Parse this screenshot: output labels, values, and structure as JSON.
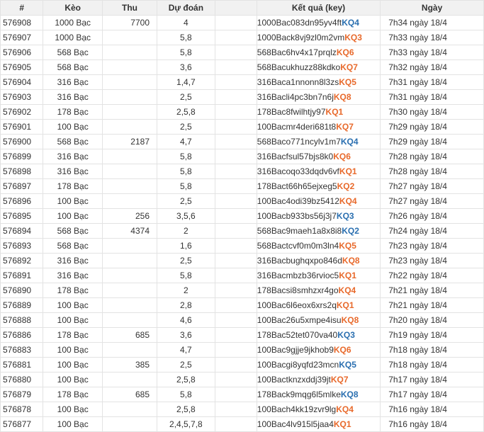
{
  "headers": {
    "id": "#",
    "bet": "Kèo",
    "thu": "Thu",
    "pred": "Dự đoán",
    "key": "Kết quả (key)",
    "date": "Ngày"
  },
  "colors": {
    "kq_orange": "#e8692b",
    "kq_blue": "#2a6fb0"
  },
  "rows": [
    {
      "id": "576908",
      "bet": "1000 Bạc",
      "thu": "7700",
      "pred": "4",
      "key": "1000Bac083dn95yv4ft",
      "kq": "KQ4",
      "kq_color": "#2a6fb0",
      "date": "7h34 ngày 18/4"
    },
    {
      "id": "576907",
      "bet": "1000 Bạc",
      "thu": "",
      "pred": "5,8",
      "key": "1000Back8vj9zl0m2vm",
      "kq": "KQ3",
      "kq_color": "#e8692b",
      "date": "7h33 ngày 18/4"
    },
    {
      "id": "576906",
      "bet": "568 Bạc",
      "thu": "",
      "pred": "5,8",
      "key": "568Bac6hv4x17prqlz",
      "kq": "KQ6",
      "kq_color": "#e8692b",
      "date": "7h33 ngày 18/4"
    },
    {
      "id": "576905",
      "bet": "568 Bạc",
      "thu": "",
      "pred": "3,6",
      "key": "568Bacukhuzz88kdko",
      "kq": "KQ7",
      "kq_color": "#e8692b",
      "date": "7h32 ngày 18/4"
    },
    {
      "id": "576904",
      "bet": "316 Bạc",
      "thu": "",
      "pred": "1,4,7",
      "key": "316Baca1nnonn8l3zs",
      "kq": "KQ5",
      "kq_color": "#e8692b",
      "date": "7h31 ngày 18/4"
    },
    {
      "id": "576903",
      "bet": "316 Bạc",
      "thu": "",
      "pred": "2,5",
      "key": "316Bacli4pc3bn7n6j",
      "kq": "KQ8",
      "kq_color": "#e8692b",
      "date": "7h31 ngày 18/4"
    },
    {
      "id": "576902",
      "bet": "178 Bạc",
      "thu": "",
      "pred": "2,5,8",
      "key": "178Bac8fwilhtjy97",
      "kq": "KQ1",
      "kq_color": "#e8692b",
      "date": "7h30 ngày 18/4"
    },
    {
      "id": "576901",
      "bet": "100 Bạc",
      "thu": "",
      "pred": "2,5",
      "key": "100Bacmr4deri681t8",
      "kq": "KQ7",
      "kq_color": "#e8692b",
      "date": "7h29 ngày 18/4"
    },
    {
      "id": "576900",
      "bet": "568 Bạc",
      "thu": "2187",
      "pred": "4,7",
      "key": "568Baco771ncylv1m7",
      "kq": "KQ4",
      "kq_color": "#2a6fb0",
      "date": "7h29 ngày 18/4"
    },
    {
      "id": "576899",
      "bet": "316 Bạc",
      "thu": "",
      "pred": "5,8",
      "key": "316Bacfsul57bjs8k0",
      "kq": "KQ6",
      "kq_color": "#e8692b",
      "date": "7h28 ngày 18/4"
    },
    {
      "id": "576898",
      "bet": "316 Bạc",
      "thu": "",
      "pred": "5,8",
      "key": "316Bacoqo33dqdv6vf",
      "kq": "KQ1",
      "kq_color": "#e8692b",
      "date": "7h28 ngày 18/4"
    },
    {
      "id": "576897",
      "bet": "178 Bạc",
      "thu": "",
      "pred": "5,8",
      "key": "178Bact66h65ejxeg5",
      "kq": "KQ2",
      "kq_color": "#e8692b",
      "date": "7h27 ngày 18/4"
    },
    {
      "id": "576896",
      "bet": "100 Bạc",
      "thu": "",
      "pred": "2,5",
      "key": "100Bac4odi39bz5412",
      "kq": "KQ4",
      "kq_color": "#e8692b",
      "date": "7h27 ngày 18/4"
    },
    {
      "id": "576895",
      "bet": "100 Bạc",
      "thu": "256",
      "pred": "3,5,6",
      "key": "100Bacb933bs56j3j7",
      "kq": "KQ3",
      "kq_color": "#2a6fb0",
      "date": "7h26 ngày 18/4"
    },
    {
      "id": "576894",
      "bet": "568 Bạc",
      "thu": "4374",
      "pred": "2",
      "key": "568Bac9maeh1a8x8i8",
      "kq": "KQ2",
      "kq_color": "#2a6fb0",
      "date": "7h24 ngày 18/4"
    },
    {
      "id": "576893",
      "bet": "568 Bạc",
      "thu": "",
      "pred": "1,6",
      "key": "568Bactcvf0m0m3ln4",
      "kq": "KQ5",
      "kq_color": "#e8692b",
      "date": "7h23 ngày 18/4"
    },
    {
      "id": "576892",
      "bet": "316 Bạc",
      "thu": "",
      "pred": "2,5",
      "key": "316Bacbughqxpo846d",
      "kq": "KQ8",
      "kq_color": "#e8692b",
      "date": "7h23 ngày 18/4"
    },
    {
      "id": "576891",
      "bet": "316 Bạc",
      "thu": "",
      "pred": "5,8",
      "key": "316Bacmbzb36rvioc5",
      "kq": "KQ1",
      "kq_color": "#e8692b",
      "date": "7h22 ngày 18/4"
    },
    {
      "id": "576890",
      "bet": "178 Bạc",
      "thu": "",
      "pred": "2",
      "key": "178Bacsi8smhzxr4go",
      "kq": "KQ4",
      "kq_color": "#e8692b",
      "date": "7h21 ngày 18/4"
    },
    {
      "id": "576889",
      "bet": "100 Bạc",
      "thu": "",
      "pred": "2,8",
      "key": "100Bac6l6eox6xrs2q",
      "kq": "KQ1",
      "kq_color": "#e8692b",
      "date": "7h21 ngày 18/4"
    },
    {
      "id": "576888",
      "bet": "100 Bạc",
      "thu": "",
      "pred": "4,6",
      "key": "100Bac26u5xmpe4isu",
      "kq": "KQ8",
      "kq_color": "#e8692b",
      "date": "7h20 ngày 18/4"
    },
    {
      "id": "576886",
      "bet": "178 Bạc",
      "thu": "685",
      "pred": "3,6",
      "key": "178Bac52tet070va40",
      "kq": "KQ3",
      "kq_color": "#2a6fb0",
      "date": "7h19 ngày 18/4"
    },
    {
      "id": "576883",
      "bet": "100 Bạc",
      "thu": "",
      "pred": "4,7",
      "key": "100Bac9gjje9jkhob9",
      "kq": "KQ6",
      "kq_color": "#e8692b",
      "date": "7h18 ngày 18/4"
    },
    {
      "id": "576881",
      "bet": "100 Bạc",
      "thu": "385",
      "pred": "2,5",
      "key": "100Bacgi8yqfd23mcn",
      "kq": "KQ5",
      "kq_color": "#2a6fb0",
      "date": "7h18 ngày 18/4"
    },
    {
      "id": "576880",
      "bet": "100 Bạc",
      "thu": "",
      "pred": "2,5,8",
      "key": "100Bactknzxddj39jt",
      "kq": "KQ7",
      "kq_color": "#e8692b",
      "date": "7h17 ngày 18/4"
    },
    {
      "id": "576879",
      "bet": "178 Bạc",
      "thu": "685",
      "pred": "5,8",
      "key": "178Back9mqg6l5mlke",
      "kq": "KQ8",
      "kq_color": "#2a6fb0",
      "date": "7h17 ngày 18/4"
    },
    {
      "id": "576878",
      "bet": "100 Bạc",
      "thu": "",
      "pred": "2,5,8",
      "key": "100Bach4kk19zvr9lg",
      "kq": "KQ4",
      "kq_color": "#e8692b",
      "date": "7h16 ngày 18/4"
    },
    {
      "id": "576877",
      "bet": "100 Bạc",
      "thu": "",
      "pred": "2,4,5,7,8",
      "key": "100Bac4lv915l5jaa4",
      "kq": "KQ1",
      "kq_color": "#e8692b",
      "date": "7h16 ngày 18/4"
    }
  ]
}
